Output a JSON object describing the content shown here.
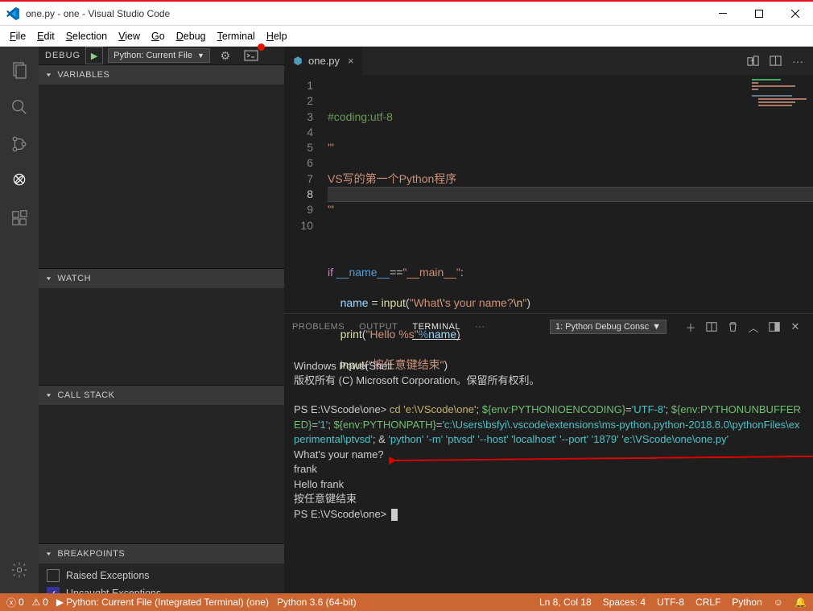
{
  "title": "one.py - one - Visual Studio Code",
  "menu": [
    "File",
    "Edit",
    "Selection",
    "View",
    "Go",
    "Debug",
    "Terminal",
    "Help"
  ],
  "debug": {
    "label": "DEBUG",
    "config": "Python: Current File"
  },
  "panels": {
    "variables": "VARIABLES",
    "watch": "WATCH",
    "callstack": "CALL STACK",
    "breakpoints": "BREAKPOINTS",
    "bp1": "Raised Exceptions",
    "bp2": "Uncaught Exceptions"
  },
  "tab": {
    "name": "one.py"
  },
  "code": {
    "l1": "#coding:utf-8",
    "l2": "'''",
    "l3": "VS写的第一个Python程序",
    "l4": "'''",
    "l6_if": "if",
    "l6_name": " __name__",
    "l6_eq": "==",
    "l6_main": "\"__main__\"",
    "l6_colon": ":",
    "l7_var": "name",
    "l7_eq": " = ",
    "l7_fn": "input",
    "l7_op": "(",
    "l7_str1": "\"What",
    "l7_esc1": "\\'",
    "l7_str2": "s your name?",
    "l7_esc2": "\\n",
    "l7_str3": "\"",
    "l7_cp": ")",
    "l8_fn": "print",
    "l8_op": "(",
    "l8_str": "\"Hello %s\"",
    "l8_pct": "%",
    "l8_var": "name",
    "l8_cp": ")",
    "l9_fn": "input",
    "l9_op": "(",
    "l9_str": "\"按任意键结束\"",
    "l9_cp": ")"
  },
  "gutter": [
    "1",
    "2",
    "3",
    "4",
    "5",
    "6",
    "7",
    "8",
    "9",
    "10"
  ],
  "term_tabs": {
    "problems": "PROBLEMS",
    "output": "OUTPUT",
    "terminal": "TERMINAL",
    "dots": "···"
  },
  "term_conf": "1: Python Debug Consc",
  "terminal": {
    "l1": "Windows PowerShell",
    "l2": "版权所有 (C) Microsoft Corporation。保留所有权利。",
    "l3_prompt": "PS E:\\VScode\\one> ",
    "l3_cmd": "cd 'e:\\VScode\\one'",
    "l3_semi": "; ",
    "l3_env1": "${env:PYTHONIOENCODING}",
    "l3_eq1": "=",
    "l3_v1": "'UTF-8'",
    "l3_semi2": "; ",
    "l3_env2": "${env:PYTHONUNBUFFERED}",
    "l3_eq2": "=",
    "l3_v2": "'1'",
    "l3_semi3": "; ",
    "l3_env3": "${env:PYTHONPATH}",
    "l3_eq3": "=",
    "l3_v3": "'c:\\Users\\bsfyi\\.vscode\\extensions\\ms-python.python-2018.8.0\\pythonFiles\\experimental\\ptvsd'",
    "l3_semi4": "; & ",
    "l3_c1": "'python'",
    "l3_c2": " '-m'",
    "l3_c3": " 'ptvsd'",
    "l3_c4": " '--host'",
    "l3_c5": " 'localhost'",
    "l3_c6": " '--port' '1879'",
    "l3_c7": " 'e:\\VScode\\one\\one.py'",
    "l4": "What's your name?",
    "l5": "frank",
    "l6": "Hello frank",
    "l7": "按任意键结束",
    "l8": "PS E:\\VScode\\one> "
  },
  "status": {
    "errors": "0",
    "warnings": "0",
    "run": "Python: Current File (Integrated Terminal) (one)",
    "py": "Python 3.6 (64-bit)",
    "pos": "Ln 8, Col 18",
    "spaces": "Spaces: 4",
    "enc": "UTF-8",
    "eol": "CRLF",
    "lang": "Python"
  }
}
